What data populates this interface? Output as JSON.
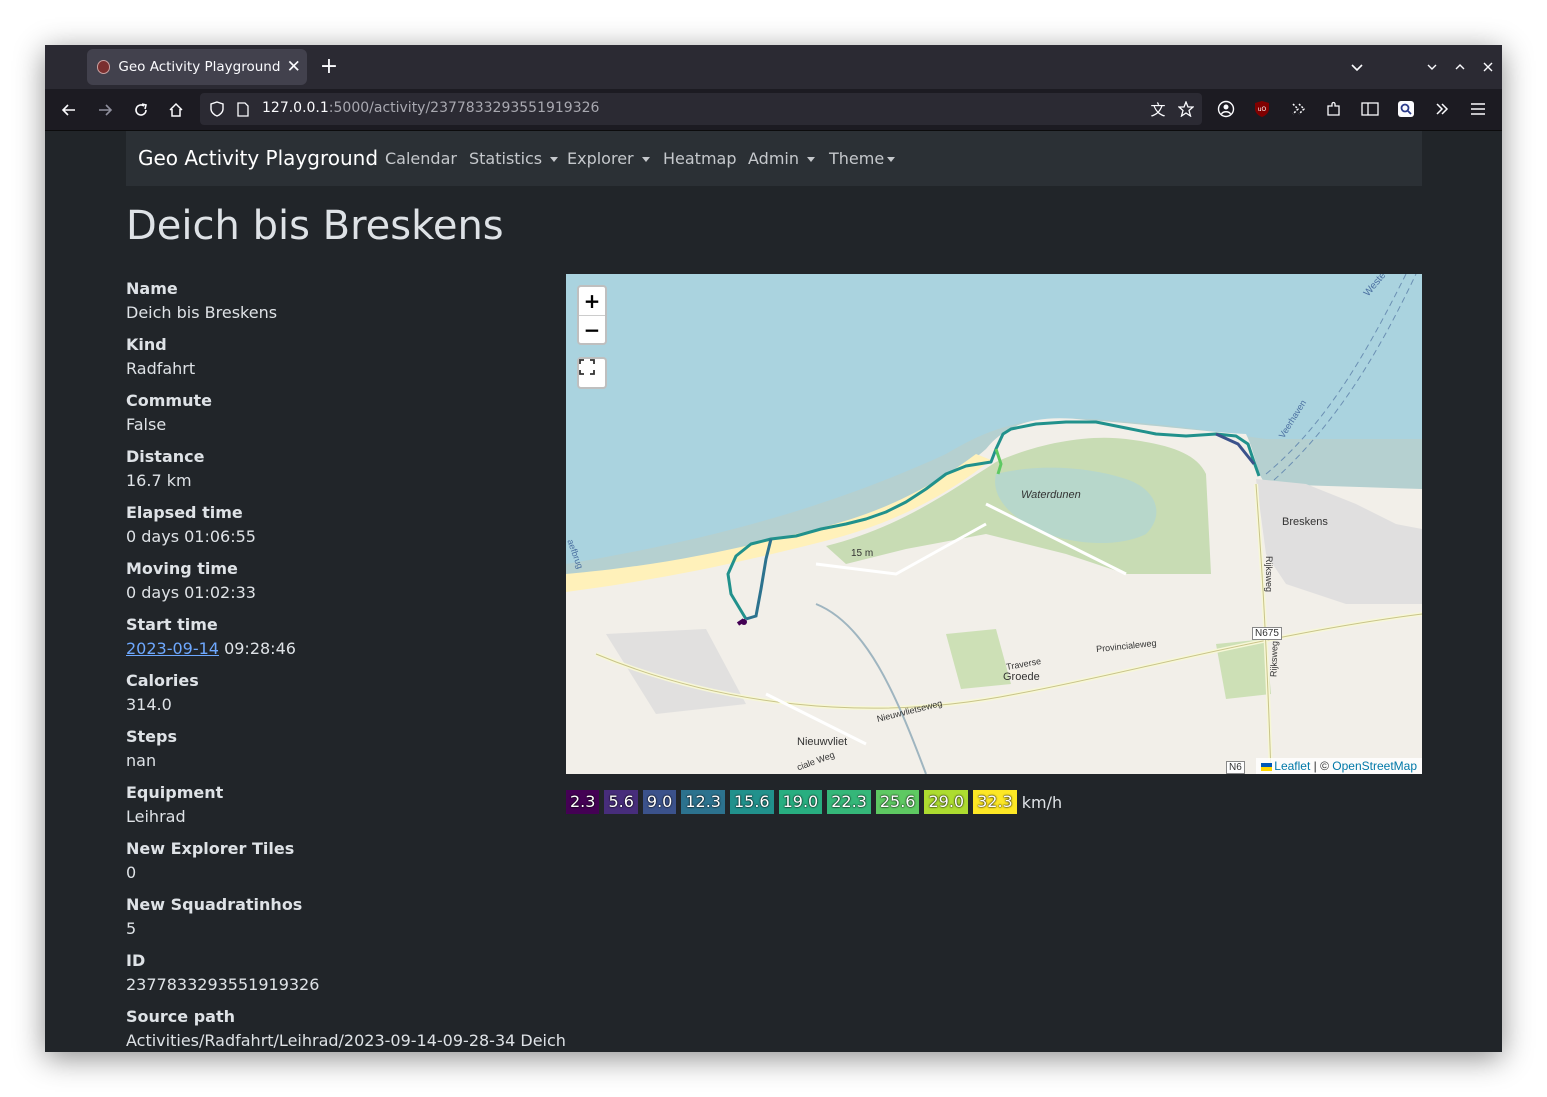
{
  "browser": {
    "tab_title": "Geo Activity Playground",
    "url_host": "127.0.0.1",
    "url_rest": ":5000/activity/2377833293551919326"
  },
  "site_nav": {
    "brand": "Geo Activity Playground",
    "items": [
      "Calendar",
      "Statistics",
      "Explorer",
      "Heatmap",
      "Admin",
      "Theme"
    ]
  },
  "page": {
    "title": "Deich bis Breskens"
  },
  "details": [
    {
      "label": "Name",
      "value": "Deich bis Breskens"
    },
    {
      "label": "Kind",
      "value": "Radfahrt"
    },
    {
      "label": "Commute",
      "value": "False"
    },
    {
      "label": "Distance",
      "value": "16.7 km"
    },
    {
      "label": "Elapsed time",
      "value": "0 days 01:06:55"
    },
    {
      "label": "Moving time",
      "value": "0 days 01:02:33"
    },
    {
      "label": "Start time",
      "value_link": "2023-09-14",
      "value_rest": " 09:28:46"
    },
    {
      "label": "Calories",
      "value": "314.0"
    },
    {
      "label": "Steps",
      "value": "nan"
    },
    {
      "label": "Equipment",
      "value": "Leihrad"
    },
    {
      "label": "New Explorer Tiles",
      "value": "0"
    },
    {
      "label": "New Squadratinhos",
      "value": "5"
    },
    {
      "label": "ID",
      "value": "2377833293551919326"
    },
    {
      "label": "Source path",
      "value": "Activities/Radfahrt/Leihrad/2023-09-14-09-28-34 Deich"
    }
  ],
  "map": {
    "zoom_in": "+",
    "zoom_out": "−",
    "labels": {
      "waterdunen": "Waterdunen",
      "breskens": "Breskens",
      "groede": "Groede",
      "nieuwvliet": "Nieuwvliet",
      "elevation": "15 m",
      "provincialeweg": "Provincialeweg",
      "nieuwvlietseweg": "Nieuwvlietseweg",
      "traverse": "Traverse",
      "rijksweg1": "Rijksweg",
      "rijksweg2": "Rijksweg",
      "n675": "N675",
      "n6": "N6",
      "veerhaven": "Veerhaven",
      "weg": "ciale Weg",
      "west": "Weste",
      "beach": "aefbrug"
    },
    "attribution": {
      "leaflet": "Leaflet",
      "sep": " | © ",
      "osm": "OpenStreetMap"
    }
  },
  "legend": {
    "items": [
      {
        "value": "2.3",
        "color": "#440154"
      },
      {
        "value": "5.6",
        "color": "#472d7b"
      },
      {
        "value": "9.0",
        "color": "#3b528b"
      },
      {
        "value": "12.3",
        "color": "#2c728e"
      },
      {
        "value": "15.6",
        "color": "#21918c"
      },
      {
        "value": "19.0",
        "color": "#28ae80"
      },
      {
        "value": "22.3",
        "color": "#35b779"
      },
      {
        "value": "25.6",
        "color": "#5ec962"
      },
      {
        "value": "29.0",
        "color": "#addc30"
      },
      {
        "value": "32.3",
        "color": "#fde725"
      }
    ],
    "unit": "km/h"
  }
}
